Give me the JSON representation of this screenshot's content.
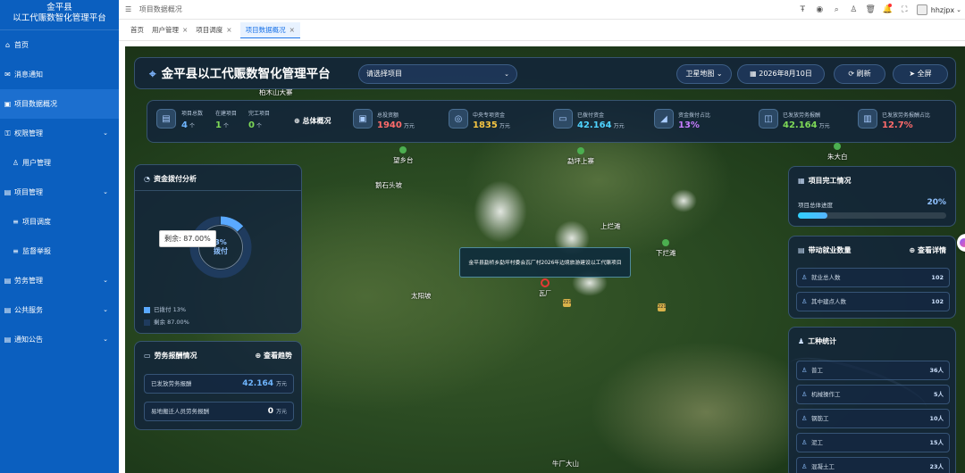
{
  "sidebar": {
    "title_line1": "金平县",
    "title_line2": "以工代赈数智化管理平台",
    "items": [
      {
        "label": "首页",
        "icon": "home-icon"
      },
      {
        "label": "消息通知",
        "icon": "message-icon"
      },
      {
        "label": "项目数据概况",
        "icon": "data-overview-icon",
        "active": true
      },
      {
        "label": "权限管理",
        "icon": "lock-icon",
        "expandable": true
      },
      {
        "label": "用户管理",
        "icon": "user-icon",
        "sub": true
      },
      {
        "label": "项目管理",
        "icon": "folder-icon",
        "expandable": true
      },
      {
        "label": "项目调度",
        "icon": "list-icon",
        "sub": true
      },
      {
        "label": "监督举报",
        "icon": "list-icon",
        "sub": true
      },
      {
        "label": "劳务管理",
        "icon": "folder-icon",
        "expandable": true
      },
      {
        "label": "公共服务",
        "icon": "folder-icon",
        "expandable": true
      },
      {
        "label": "通知公告",
        "icon": "folder-icon",
        "expandable": true
      }
    ]
  },
  "topbar": {
    "breadcrumb": "项目数据概况",
    "username": "hhzjpx"
  },
  "tabs": [
    {
      "label": "首页",
      "closable": false
    },
    {
      "label": "用户管理",
      "closable": true
    },
    {
      "label": "项目调度",
      "closable": true
    },
    {
      "label": "项目数据概况",
      "closable": true,
      "active": true
    }
  ],
  "dashboard": {
    "title": "金平县以工代赈数智化管理平台",
    "project_select_placeholder": "请选择项目",
    "map_type": "卫星地图",
    "date": "2026年8月10日",
    "refresh_label": "刷新",
    "fullscreen_label": "全屏"
  },
  "stats": {
    "project_total_label": "项目总数",
    "project_total": "4",
    "project_total_unit": "个",
    "in_progress_label": "在建项目",
    "in_progress": "1",
    "in_progress_unit": "个",
    "completed_label": "完工项目",
    "completed": "0",
    "completed_unit": "个",
    "overview_label": "总体概况",
    "items": [
      {
        "label": "总投资额",
        "value": "1940",
        "unit": "万元",
        "color": "#ff6b6b",
        "icon": "money-icon"
      },
      {
        "label": "中央专项资金",
        "value": "1835",
        "unit": "万元",
        "color": "#f5c542",
        "icon": "database-icon"
      },
      {
        "label": "已拨付资金",
        "value": "42.164",
        "unit": "万元",
        "color": "#4fd3ff",
        "icon": "wallet-icon"
      },
      {
        "label": "资金拨付占比",
        "value": "13%",
        "unit": "",
        "color": "#c77dff",
        "icon": "chart-icon"
      },
      {
        "label": "已发放劳务报酬",
        "value": "42.164",
        "unit": "万元",
        "color": "#7ed957",
        "icon": "payment-icon"
      },
      {
        "label": "已发放劳务报酬占比",
        "value": "12.7%",
        "unit": "",
        "color": "#ff6b6b",
        "icon": "ratio-icon"
      }
    ]
  },
  "fund": {
    "title": "资金拨付分析",
    "center_line1": "3%",
    "center_line2": "拨付",
    "tooltip": "剩余: 87.00%",
    "legend_paid": "已拨付 13%",
    "legend_remaining": "剩余 87.00%",
    "paid_pct": 13,
    "paid_color": "#5aa9ff",
    "remaining_color": "#1f3b5e"
  },
  "labor": {
    "title": "劳务报酬情况",
    "link": "查看趋势",
    "rows": [
      {
        "label": "已发放劳务报酬",
        "value": "42.164",
        "unit": "万元"
      },
      {
        "label": "易地搬迁人员劳务报酬",
        "value": "0",
        "unit": "万元"
      }
    ]
  },
  "completion": {
    "title": "项目完工情况",
    "progress_label": "项目总体进度",
    "progress_pct": "20%",
    "progress_value": 20
  },
  "employment": {
    "title": "带动就业数量",
    "link": "查看详情",
    "rows": [
      {
        "label": "就业总人数",
        "value": "102"
      },
      {
        "label": "其中建点人数",
        "value": "102"
      }
    ]
  },
  "workers": {
    "title": "工种统计",
    "rows": [
      {
        "label": "普工",
        "value": "36人"
      },
      {
        "label": "机械操作工",
        "value": "5人"
      },
      {
        "label": "钢筋工",
        "value": "10人"
      },
      {
        "label": "泥工",
        "value": "15人"
      },
      {
        "label": "混凝土工",
        "value": "23人"
      }
    ]
  },
  "map": {
    "popup": "金平县勐桥乡勐坪村委会瓦厂村2026年边境旅游建设以工代赈项目",
    "pin_label": "瓦厂",
    "labels": [
      "柏木山大寨",
      "望乡台",
      "鹅石头坡",
      "勐坪上寨",
      "上烂滩",
      "下烂滩",
      "太阳坡",
      "朱大白",
      "牛厂大山"
    ],
    "road_signs": [
      "221",
      "221"
    ]
  }
}
